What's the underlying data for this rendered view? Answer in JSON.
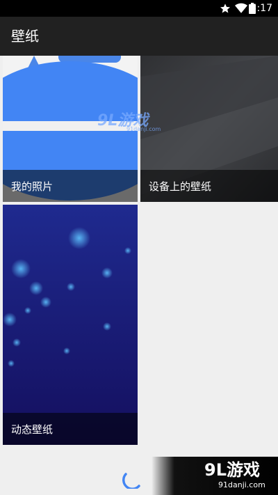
{
  "status_bar": {
    "time": "5:17",
    "icons": [
      "star-icon",
      "wifi-icon",
      "battery-icon"
    ]
  },
  "app_bar": {
    "title": "壁纸"
  },
  "tiles": [
    {
      "id": "photos",
      "label": "我的照片"
    },
    {
      "id": "device",
      "label": "设备上的壁纸"
    },
    {
      "id": "live",
      "label": "动态壁纸"
    }
  ],
  "watermark": {
    "logo": "9L游戏",
    "domain": "91danji.com"
  },
  "brand_footer": {
    "logo": "9L游戏",
    "domain": "91danji.com"
  },
  "colors": {
    "status_bar": "#000000",
    "app_bar": "#212121",
    "background": "#efefef",
    "accent_blue": "#4285f4",
    "live_wallpaper": "#1a237e"
  }
}
